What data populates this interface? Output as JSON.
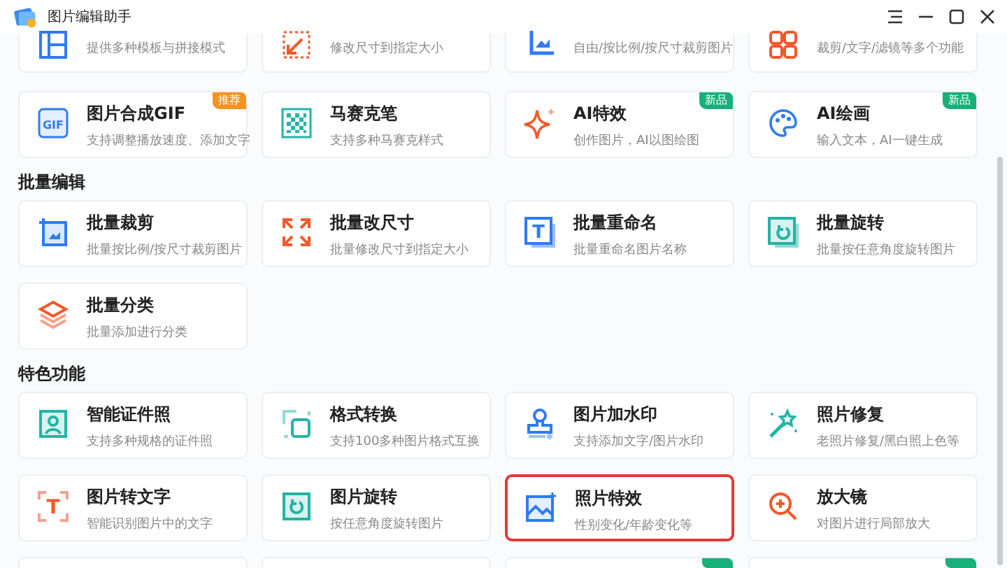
{
  "window": {
    "title": "图片编辑助手"
  },
  "partial_top_cards": [
    {
      "subtitle": "提供多种模板与拼接模式"
    },
    {
      "subtitle": "修改尺寸到指定大小"
    },
    {
      "subtitle": "自由/按比例/按尺寸裁剪图片"
    },
    {
      "subtitle": "裁剪/文字/滤镜等多个功能"
    }
  ],
  "cards": [
    {
      "title": "图片合成GIF",
      "subtitle": "支持调整播放速度、添加文字",
      "badge": {
        "text": "推荐",
        "kind": "recommend"
      },
      "icon_text": "GIF",
      "selected": false
    },
    {
      "title": "马赛克笔",
      "subtitle": "支持多种马赛克样式",
      "selected": false
    },
    {
      "title": "AI特效",
      "subtitle": "创作图片，AI以图绘图",
      "badge": {
        "text": "新品",
        "kind": "new"
      },
      "selected": false
    },
    {
      "title": "AI绘画",
      "subtitle": "输入文本，AI一键生成",
      "badge": {
        "text": "新品",
        "kind": "new"
      },
      "selected": false
    }
  ],
  "sections": [
    {
      "heading": "批量编辑",
      "cards": [
        {
          "title": "批量裁剪",
          "subtitle": "批量按比例/按尺寸裁剪图片",
          "selected": false
        },
        {
          "title": "批量改尺寸",
          "subtitle": "批量修改尺寸到指定大小",
          "selected": false
        },
        {
          "title": "批量重命名",
          "subtitle": "批量重命名图片名称",
          "icon_text": "T",
          "selected": false
        },
        {
          "title": "批量旋转",
          "subtitle": "批量按任意角度旋转图片",
          "selected": false
        },
        {
          "title": "批量分类",
          "subtitle": "批量添加进行分类",
          "selected": false
        }
      ]
    },
    {
      "heading": "特色功能",
      "cards": [
        {
          "title": "智能证件照",
          "subtitle": "支持多种规格的证件照",
          "selected": false
        },
        {
          "title": "格式转换",
          "subtitle": "支持100多种图片格式互换",
          "selected": false
        },
        {
          "title": "图片加水印",
          "subtitle": "支持添加文字/图片水印",
          "selected": false
        },
        {
          "title": "照片修复",
          "subtitle": "老照片修复/黑白照上色等",
          "selected": false
        },
        {
          "title": "图片转文字",
          "subtitle": "智能识别图片中的文字",
          "icon_text": "T",
          "selected": false
        },
        {
          "title": "图片旋转",
          "subtitle": "按任意角度旋转图片",
          "selected": false
        },
        {
          "title": "照片特效",
          "subtitle": "性别变化/年龄变化等",
          "selected": true
        },
        {
          "title": "放大镜",
          "subtitle": "对图片进行局部放大",
          "selected": false
        }
      ]
    }
  ],
  "partial_bottom_cards": [
    {
      "new_badge": false
    },
    {
      "new_badge": false
    },
    {
      "new_badge": true
    },
    {
      "new_badge": true
    }
  ]
}
